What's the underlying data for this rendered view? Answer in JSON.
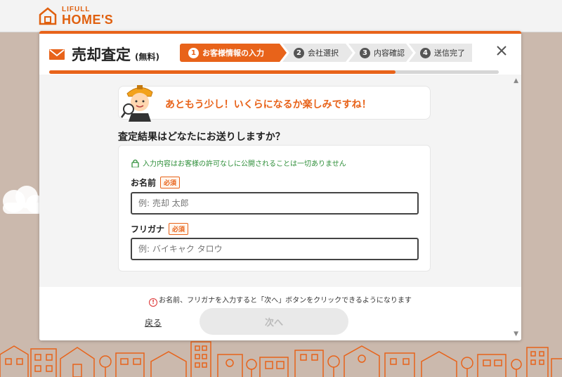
{
  "site": {
    "logo_small": "LIFULL",
    "logo_big": "HOME'S",
    "brand_color": "#e8631a"
  },
  "modal": {
    "title": "売却査定",
    "title_sub": "(無料)",
    "steps": [
      {
        "num": "1",
        "label": "お客様情報の入力",
        "active": true
      },
      {
        "num": "2",
        "label": "会社選択",
        "active": false
      },
      {
        "num": "3",
        "label": "内容確認",
        "active": false
      },
      {
        "num": "4",
        "label": "送信完了",
        "active": false
      }
    ],
    "progress": 0.77,
    "close_icon": "close-icon"
  },
  "content": {
    "bubble_text": "あともう少し！いくらになるか楽しみですね！",
    "question": "査定結果はどなたにお送りしますか？",
    "privacy_note": "入力内容はお客様の許可なしに公開されることは一切ありません",
    "fields": [
      {
        "label": "お名前",
        "required": "必須",
        "value": "",
        "placeholder": "例: 売却 太郎"
      },
      {
        "label": "フリガナ",
        "required": "必須",
        "value": "",
        "placeholder": "例: バイキャク タロウ"
      }
    ]
  },
  "footer": {
    "notice": "お名前、フリガナを入力すると「次へ」ボタンをクリックできるようになります",
    "back_label": "戻る",
    "next_label": "次へ"
  }
}
